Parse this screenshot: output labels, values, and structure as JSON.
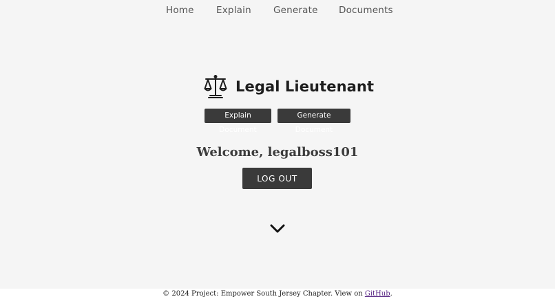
{
  "nav": {
    "items": [
      {
        "label": "Home"
      },
      {
        "label": "Explain"
      },
      {
        "label": "Generate"
      },
      {
        "label": "Documents"
      }
    ]
  },
  "brand": {
    "title": "Legal Lieutenant",
    "logo_icon": "scales-of-justice-icon"
  },
  "actions": {
    "explain_label": "Explain Document",
    "generate_label": "Generate Document"
  },
  "user": {
    "welcome": "Welcome, legalboss101",
    "logout_label": "LOG OUT"
  },
  "scroll": {
    "icon": "chevron-down-icon"
  },
  "footer": {
    "text_prefix": "© 2024 Project: Empower South Jersey Chapter. View on ",
    "link_label": "GitHub",
    "text_suffix": "."
  },
  "colors": {
    "background": "#f5f5f5",
    "button": "#3a3a3a",
    "link": "#5b2a86"
  }
}
